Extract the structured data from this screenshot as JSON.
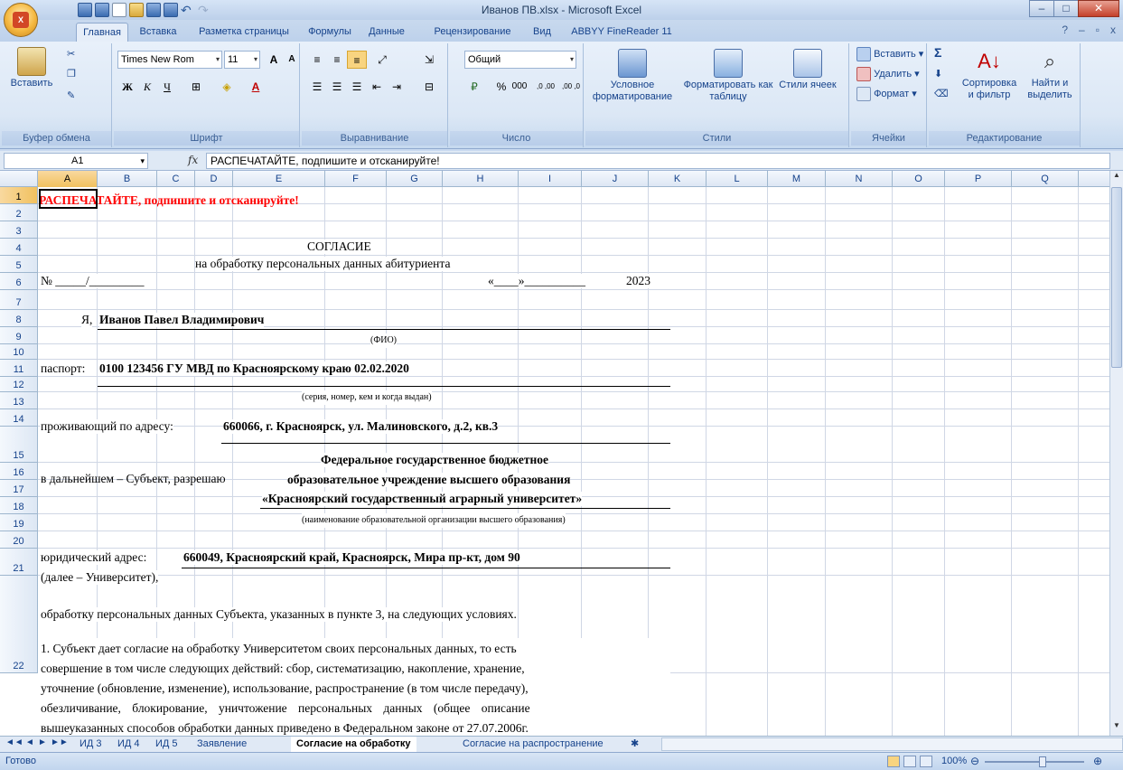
{
  "window": {
    "title": "Иванов ПВ.xlsx - Microsoft Excel"
  },
  "ribbon_tabs": [
    "Главная",
    "Вставка",
    "Разметка страницы",
    "Формулы",
    "Данные",
    "Рецензирование",
    "Вид",
    "ABBYY FineReader 11"
  ],
  "ribbon": {
    "clipboard": {
      "paste": "Вставить",
      "label": "Буфер обмена"
    },
    "font": {
      "name": "Times New Rom",
      "size": "11",
      "label": "Шрифт",
      "bold": "Ж",
      "italic": "К",
      "underline": "Ч"
    },
    "alignment": {
      "label": "Выравнивание"
    },
    "number": {
      "format": "Общий",
      "label": "Число",
      "percent": "%",
      "thousands": "000",
      "inc_dec": ",0 ,00",
      "dec_dec": ",00 ,0"
    },
    "styles": {
      "conditional": "Условное форматирование",
      "as_table": "Форматировать как таблицу",
      "cell_styles": "Стили ячеек",
      "label": "Стили"
    },
    "cells": {
      "insert": "Вставить",
      "delete": "Удалить",
      "format": "Формат",
      "label": "Ячейки"
    },
    "editing": {
      "sort": "Сортировка и фильтр",
      "find": "Найти и выделить",
      "label": "Редактирование",
      "sigma": "Σ"
    }
  },
  "formula_bar": {
    "cell_ref": "A1",
    "fx": "fx",
    "content": "РАСПЕЧАТАЙТЕ, подпишите и отсканируйте!"
  },
  "columns": [
    "A",
    "B",
    "C",
    "D",
    "E",
    "F",
    "G",
    "H",
    "I",
    "J",
    "K",
    "L",
    "M",
    "N",
    "O",
    "P",
    "Q"
  ],
  "rows": [
    "1",
    "2",
    "3",
    "4",
    "5",
    "6",
    "7",
    "8",
    "9",
    "10",
    "11",
    "12",
    "13",
    "14",
    "15",
    "16",
    "17",
    "18",
    "19",
    "20",
    "21",
    "22"
  ],
  "cells": {
    "r1": "РАСПЕЧАТАЙТЕ, подпишите и отсканируйте!",
    "r3": "СОГЛАСИЕ",
    "r4": "на обработку персональных данных абитуриента",
    "r5_no": "№ _____/_________",
    "r5_date": "«____»__________",
    "r5_year": "2023",
    "r7_ya": "Я,",
    "r7_name": "Иванов Павел Владимирович",
    "r8": "(ФИО)",
    "r10_label": "паспорт:",
    "r10_value": "0100 123456 ГУ МВД по Красноярскому краю 02.02.2020",
    "r11": "(серия, номер, кем и когда выдан)",
    "r13_label": "проживающий по адресу:",
    "r13_value": "660066, г. Красноярск, ул. Малиновского, д.2, кв.3",
    "r15_label": "в дальнейшем – Субъект, разрешаю",
    "r15_org1": "Федеральное государственное бюджетное",
    "r15_org2": "образовательное учреждение высшего образования",
    "r15_org3": "«Красноярский государственный аграрный университет»",
    "r16": "(наименование образовательной организации высшего образования)",
    "r18_label": "юридический адрес:",
    "r18_value": "660049, Красноярский край, Красноярск, Мира пр-кт, дом 90",
    "r19": "(далее – Университет),",
    "r21": "обработку персональных данных Субъекта, указанных в пункте 3, на следующих условиях.",
    "r22": [
      "1. Субъект дает согласие на обработку Университетом своих персональных данных, то есть",
      "совершение в том числе следующих действий: сбор, систематизацию, накопление, хранение,",
      "уточнение (обновление, изменение), использование, распространение (в том числе передачу),",
      "обезличивание, блокирование, уничтожение персональных данных (общее описание",
      "вышеуказанных способов обработки данных приведено в Федеральном законе от 27.07.2006г."
    ]
  },
  "sheet_tabs": [
    "ИД 3",
    "ИД 4",
    "ИД 5",
    "Заявление",
    "Согласие на обработку",
    "Согласие на распространение"
  ],
  "active_sheet": "Согласие на обработку",
  "status": {
    "text": "Готово",
    "zoom": "100%"
  }
}
